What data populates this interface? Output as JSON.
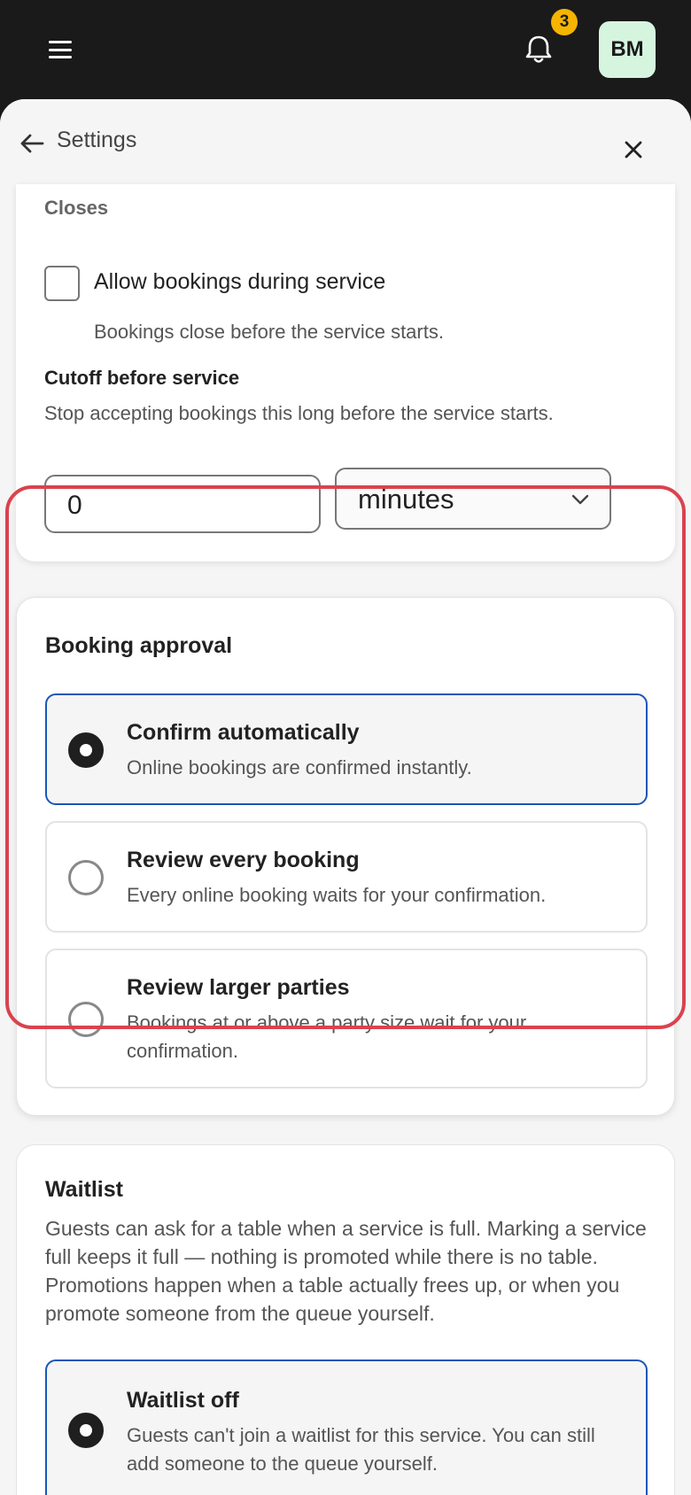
{
  "topbar": {
    "menu_icon": "hamburger-icon",
    "notification_icon": "bell-icon",
    "notification_count": "3",
    "avatar_initials": "BM",
    "colors": {
      "background": "#1a1a1a",
      "badge": "#f4b400",
      "avatar_bg": "#d6f5df"
    }
  },
  "panel": {
    "title": "Settings",
    "back_icon": "arrow-left-icon",
    "close_icon": "close-icon"
  },
  "closes": {
    "heading": "Closes",
    "allow_label": "Allow bookings during service",
    "allow_checked": false,
    "allow_help": "Bookings close before the service starts.",
    "cutoff_heading": "Cutoff before service",
    "cutoff_help": "Stop accepting bookings this long before the service starts.",
    "cutoff_value": "0",
    "cutoff_unit": "minutes"
  },
  "approval": {
    "heading": "Booking approval",
    "options": [
      {
        "title": "Confirm automatically",
        "desc": "Online bookings are confirmed instantly.",
        "selected": true
      },
      {
        "title": "Review every booking",
        "desc": "Every online booking waits for your confirmation.",
        "selected": false
      },
      {
        "title": "Review larger parties",
        "desc": "Bookings at or above a party size wait for your confirmation.",
        "selected": false
      }
    ],
    "highlight_color": "#d9434e",
    "selected_color": "#1a56b8"
  },
  "waitlist": {
    "heading": "Waitlist",
    "desc": "Guests can ask for a table when a service is full. Marking a service full keeps it full — nothing is promoted while there is no table. Promotions happen when a table actually frees up, or when you promote someone from the queue yourself.",
    "options": [
      {
        "title": "Waitlist off",
        "desc": "Guests can't join a waitlist for this service. You can still add someone to the queue yourself.",
        "selected": true
      }
    ]
  }
}
